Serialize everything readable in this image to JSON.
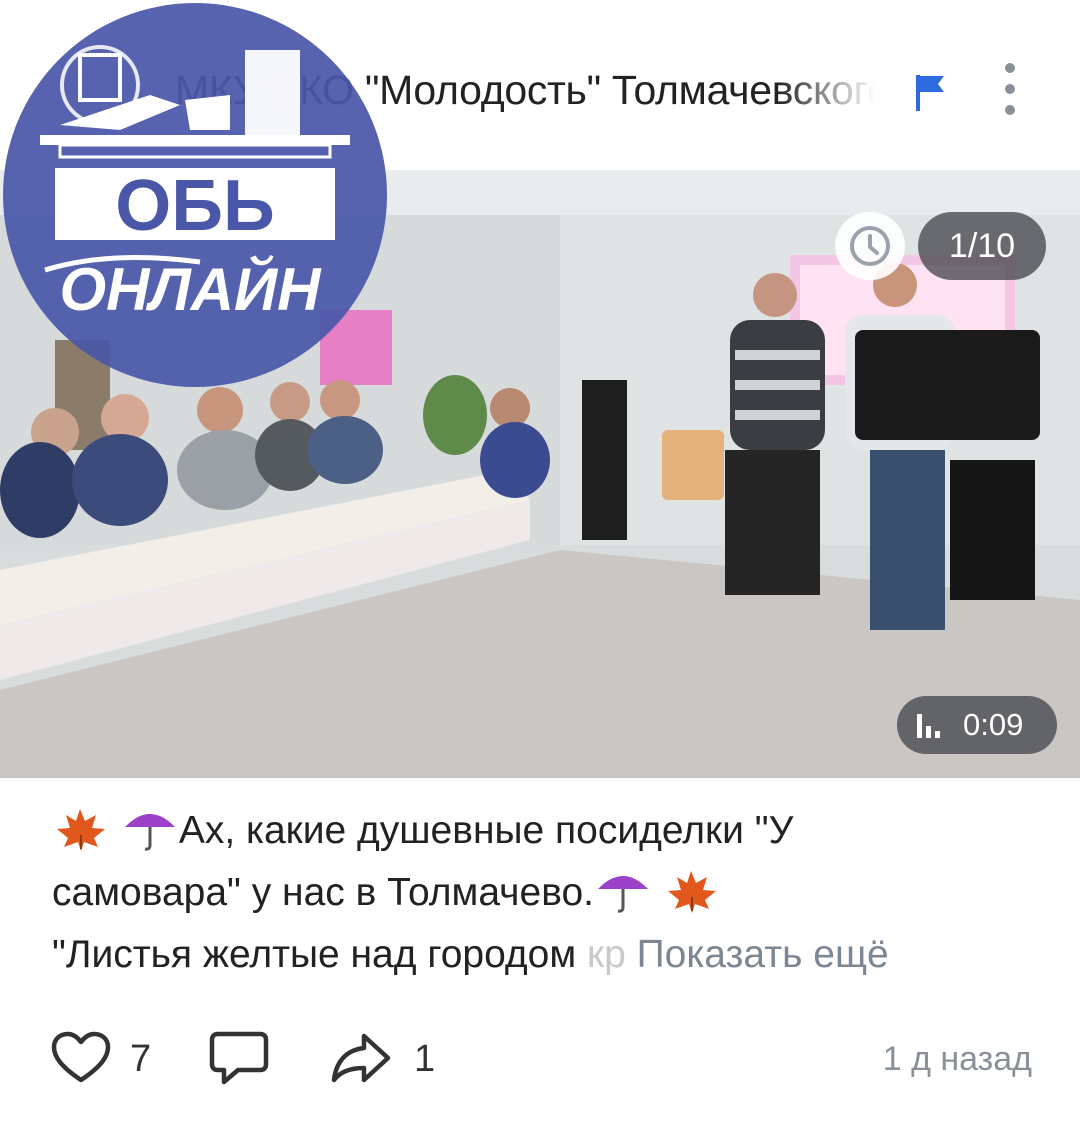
{
  "post": {
    "author_name": "МКУ СКО \"Молодость\" Толмачевского сельсовета",
    "watermark": {
      "line1": "ОБЬ",
      "line2": "ОНЛАЙН"
    },
    "media": {
      "counter": "1/10",
      "duration": "0:09",
      "icons": {
        "clock": "clock-icon",
        "bars": "bar-chart-icon"
      }
    },
    "caption": {
      "line1_text": "Ах, какие душевные посиделки \"У",
      "line2_text": "самовара\" у нас в Толмачево.",
      "line3_text": "\"Листья желтые над городом ",
      "line3_faded": "кр",
      "show_more": "Показать ещё",
      "emoji": {
        "leaf": "maple-leaf-emoji",
        "umbrella": "umbrella-emoji"
      }
    },
    "footer": {
      "likes": "7",
      "comments": "",
      "shares": "1",
      "time": "1 д назад"
    }
  },
  "colors": {
    "accent": "#2d6ce0",
    "logo_bg": "#4a57a8",
    "muted": "#8a9099"
  }
}
